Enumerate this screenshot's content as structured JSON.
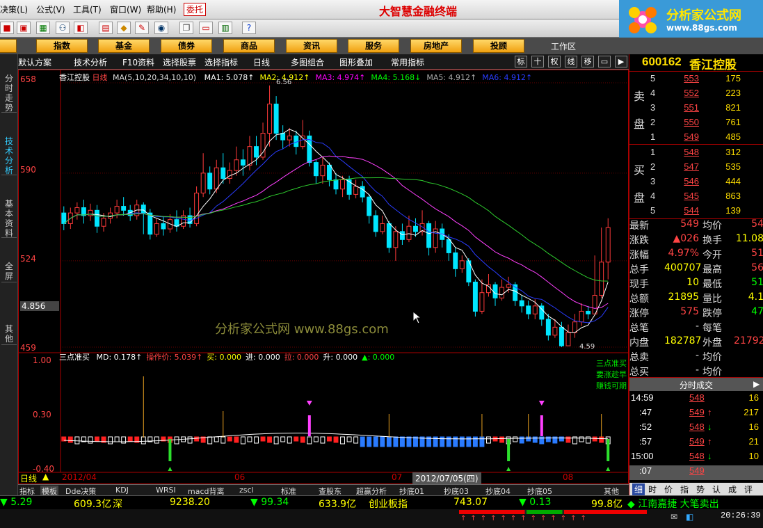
{
  "menu": {
    "items": [
      "决策(L)",
      "公式(V)",
      "工具(T)",
      "窗口(W)",
      "帮助(H)"
    ],
    "trade": "委托",
    "app_title": "大智慧金融终端"
  },
  "logo": {
    "name": "分析家公式网",
    "url": "www.88gs.com"
  },
  "categories": [
    "股",
    "指数",
    "基金",
    "债券",
    "商品",
    "资讯",
    "服务",
    "房地产",
    "投顾"
  ],
  "workarea": "工作区",
  "side_tabs": [
    "分时走势",
    "技术分析",
    "基本资料",
    "全屏",
    "其他"
  ],
  "chart_tabs": [
    "默认方案",
    "技术分析",
    "F10资料",
    "选择股票",
    "选择指标",
    "日线",
    "多图组合",
    "图形叠加",
    "常用指标"
  ],
  "chart_tools": [
    "标",
    "十",
    "权",
    "线",
    "移",
    "▭",
    "▶"
  ],
  "stock": {
    "code": "600162",
    "name": "香江控股"
  },
  "ma_line": {
    "label": "香江控股",
    "period": "日线",
    "ma": "MA(5,10,20,34,10,10)",
    "items": [
      {
        "t": "MA1: 5.078↑",
        "c": "#ffffff"
      },
      {
        "t": "MA2: 4.912↑",
        "c": "#ffff00"
      },
      {
        "t": "MA3: 4.974↑",
        "c": "#ff00ff"
      },
      {
        "t": "MA4: 5.168↓",
        "c": "#00ff00"
      },
      {
        "t": "MA5: 4.912↑",
        "c": "#aaaaaa"
      },
      {
        "t": "MA6: 4.912↑",
        "c": "#2a3cff"
      }
    ]
  },
  "y_labels": [
    "658",
    "590",
    "524",
    "459"
  ],
  "cursor_price": "4.856",
  "annotations": {
    "high": "6.56",
    "low": "4.59"
  },
  "watermark": "分析家公式网  www.88gs.com",
  "sub_header": {
    "name": "三点准买",
    "items": [
      {
        "t": "MD: 0.178↑",
        "c": "#ffffff"
      },
      {
        "t": "操作价: 5.039↑",
        "c": "#ff4444"
      },
      {
        "t": "买: 0.000",
        "c": "#ffff00"
      },
      {
        "t": "进: 0.000",
        "c": "#ffffff"
      },
      {
        "t": "拉: 0.000",
        "c": "#ff4444"
      },
      {
        "t": "升: 0.000",
        "c": "#ffffff"
      },
      {
        "t": "▲: 0.000",
        "c": "#00ff00"
      }
    ]
  },
  "sub_y": [
    "1.00",
    "0.30",
    "-0.40"
  ],
  "sub_note": [
    "三点准买",
    "要涨趁早",
    "赚钱可期"
  ],
  "x_axis": {
    "period": "日线",
    "months": [
      "2012/04",
      "06",
      "07",
      "08"
    ],
    "cursor_date": "2012/07/05(四)"
  },
  "bottom_tabs": [
    "指标",
    "模板",
    "Dde决策",
    "KDJ",
    "WRSI",
    "macd背离",
    "zscl",
    "标准",
    "查股东",
    "超赢分析",
    "抄底01",
    "抄底03",
    "抄底04",
    "抄底05",
    "其他"
  ],
  "orderbook": {
    "sell_label": [
      "卖",
      "盘"
    ],
    "buy_label": [
      "买",
      "盘"
    ],
    "sell": [
      {
        "l": "5",
        "p": "553",
        "v": "175"
      },
      {
        "l": "4",
        "p": "552",
        "v": "223"
      },
      {
        "l": "3",
        "p": "551",
        "v": "821"
      },
      {
        "l": "2",
        "p": "550",
        "v": "761"
      },
      {
        "l": "1",
        "p": "549",
        "v": "485"
      }
    ],
    "buy": [
      {
        "l": "1",
        "p": "548",
        "v": "312"
      },
      {
        "l": "2",
        "p": "547",
        "v": "535"
      },
      {
        "l": "3",
        "p": "546",
        "v": "444"
      },
      {
        "l": "4",
        "p": "545",
        "v": "863"
      },
      {
        "l": "5",
        "p": "544",
        "v": "139"
      }
    ]
  },
  "stats": [
    {
      "k1": "最新",
      "v1": "549",
      "c1": "#ff4444",
      "k2": "均价",
      "v2": "54",
      "c2": "#ff4444"
    },
    {
      "k1": "涨跌",
      "v1": "▲026",
      "c1": "#ff4444",
      "k2": "换手",
      "v2": "11.08",
      "c2": "#ffff00"
    },
    {
      "k1": "涨幅",
      "v1": "4.97%",
      "c1": "#ff4444",
      "k2": "今开",
      "v2": "51",
      "c2": "#ff4444"
    },
    {
      "k1": "总手",
      "v1": "400707",
      "c1": "#ffff00",
      "k2": "最高",
      "v2": "56",
      "c2": "#ff4444"
    },
    {
      "k1": "现手",
      "v1": "10",
      "c1": "#ffff00",
      "k2": "最低",
      "v2": "51",
      "c2": "#00ff00"
    },
    {
      "k1": "总额",
      "v1": "21895",
      "c1": "#ffff00",
      "k2": "量比",
      "v2": "4.1",
      "c2": "#ffff00"
    },
    {
      "k1": "涨停",
      "v1": "575",
      "c1": "#ff4444",
      "k2": "跌停",
      "v2": "47",
      "c2": "#00ff00"
    },
    {
      "k1": "总笔",
      "v1": "-",
      "c1": "#dddddd",
      "k2": "每笔",
      "v2": "",
      "c2": "#dddddd"
    },
    {
      "k1": "内盘",
      "v1": "182787",
      "c1": "#ffff00",
      "k2": "外盘",
      "v2": "21792",
      "c2": "#ff4444"
    },
    {
      "k1": "总卖",
      "v1": "-",
      "c1": "#dddddd",
      "k2": "均价",
      "v2": "",
      "c2": "#dddddd"
    },
    {
      "k1": "总买",
      "v1": "-",
      "c1": "#dddddd",
      "k2": "均价",
      "v2": "",
      "c2": "#dddddd"
    }
  ],
  "ticks_title": "分时成交",
  "ticks": [
    {
      "t": "14:59",
      "p": "548",
      "a": "",
      "v": "16"
    },
    {
      "t": ":47",
      "p": "549",
      "a": "↑",
      "v": "217"
    },
    {
      "t": ":52",
      "p": "548",
      "a": "↓",
      "v": "16"
    },
    {
      "t": ":57",
      "p": "549",
      "a": "↑",
      "v": "21"
    },
    {
      "t": "15:00",
      "p": "548",
      "a": "↓",
      "v": "10"
    },
    {
      "t": ":07",
      "p": "549",
      "a": "",
      "v": ""
    }
  ],
  "right_tabs": [
    "细",
    "时",
    "价",
    "指",
    "势",
    "认",
    "成",
    "评"
  ],
  "status": [
    {
      "t": "▼ 5.29",
      "c": "#00ff00"
    },
    {
      "t": "609.3亿",
      "c": "#ffff00"
    },
    {
      "t": "深",
      "c": "#ffff00"
    },
    {
      "t": "9238.20",
      "c": "#ffff00"
    },
    {
      "t": "▼ 99.34",
      "c": "#00ff00"
    },
    {
      "t": "633.9亿",
      "c": "#ffff00"
    },
    {
      "t": "创业板指",
      "c": "#ffff00"
    },
    {
      "t": "743.07",
      "c": "#ffff00"
    },
    {
      "t": "▼ 0.13",
      "c": "#00ff00"
    },
    {
      "t": "99.8亿",
      "c": "#ffff00"
    },
    {
      "t": "◆ 江南嘉捷 大笔卖出",
      "c": "#00ff00"
    }
  ],
  "clock": "20:26:39",
  "chart_data": {
    "type": "candlestick",
    "ylim": [
      4.59,
      6.58
    ],
    "y_ticks": [
      6.58,
      5.9,
      5.24,
      4.59
    ],
    "candles": [
      [
        5.6,
        5.52,
        5.65,
        5.47
      ],
      [
        5.52,
        5.6,
        5.64,
        5.48
      ],
      [
        5.6,
        5.64,
        5.68,
        5.55
      ],
      [
        5.64,
        5.58,
        5.7,
        5.52
      ],
      [
        5.58,
        5.62,
        5.67,
        5.54
      ],
      [
        5.62,
        5.5,
        5.66,
        5.45
      ],
      [
        5.5,
        5.56,
        5.6,
        5.46
      ],
      [
        5.56,
        5.6,
        5.64,
        5.52
      ],
      [
        5.6,
        5.65,
        5.7,
        5.56
      ],
      [
        5.65,
        5.62,
        5.72,
        5.58
      ],
      [
        5.62,
        5.58,
        5.66,
        5.54
      ],
      [
        5.58,
        5.66,
        5.7,
        5.55
      ],
      [
        5.66,
        5.6,
        5.68,
        5.44
      ],
      [
        5.6,
        5.44,
        5.63,
        5.4
      ],
      [
        5.44,
        5.52,
        5.56,
        5.42
      ],
      [
        5.52,
        5.48,
        5.57,
        5.43
      ],
      [
        5.48,
        5.55,
        5.59,
        5.45
      ],
      [
        5.55,
        5.5,
        5.62,
        5.46
      ],
      [
        5.5,
        5.58,
        5.62,
        5.48
      ],
      [
        5.58,
        5.52,
        5.64,
        5.49
      ],
      [
        5.52,
        5.75,
        5.8,
        5.5
      ],
      [
        5.75,
        5.9,
        6.05,
        5.72
      ],
      [
        5.9,
        5.78,
        5.95,
        5.74
      ],
      [
        5.78,
        5.94,
        6.0,
        5.75
      ],
      [
        5.94,
        5.86,
        6.05,
        5.82
      ],
      [
        5.86,
        5.92,
        5.98,
        5.82
      ],
      [
        5.92,
        6.0,
        6.1,
        5.88
      ],
      [
        6.0,
        5.96,
        6.08,
        5.88
      ],
      [
        5.96,
        6.1,
        6.18,
        5.92
      ],
      [
        6.1,
        6.02,
        6.18,
        5.96
      ],
      [
        6.02,
        6.2,
        6.28,
        6.0
      ],
      [
        6.2,
        6.42,
        6.56,
        6.1
      ],
      [
        6.42,
        6.2,
        6.48,
        6.15
      ],
      [
        6.2,
        6.15,
        6.26,
        6.08
      ],
      [
        6.15,
        6.18,
        6.24,
        6.1
      ],
      [
        6.18,
        6.1,
        6.22,
        6.04
      ],
      [
        6.1,
        6.18,
        6.3,
        6.08
      ],
      [
        6.18,
        5.98,
        6.22,
        5.95
      ],
      [
        5.98,
        5.88,
        6.0,
        5.82
      ],
      [
        5.88,
        5.96,
        6.02,
        5.82
      ],
      [
        5.96,
        5.85,
        5.98,
        5.8
      ],
      [
        5.85,
        5.78,
        5.9,
        5.74
      ],
      [
        5.78,
        5.85,
        5.88,
        5.72
      ],
      [
        5.85,
        5.74,
        5.88,
        5.7
      ],
      [
        5.74,
        5.8,
        5.85,
        5.71
      ],
      [
        5.8,
        5.72,
        5.84,
        5.68
      ],
      [
        5.72,
        5.58,
        5.74,
        5.52
      ],
      [
        5.58,
        5.46,
        5.62,
        5.42
      ],
      [
        5.46,
        5.52,
        5.58,
        5.44
      ],
      [
        5.52,
        5.34,
        5.54,
        5.3
      ],
      [
        5.34,
        5.46,
        5.5,
        5.24
      ],
      [
        5.46,
        5.4,
        5.52,
        5.36
      ],
      [
        5.4,
        5.5,
        5.58,
        5.38
      ],
      [
        5.5,
        5.46,
        5.56,
        5.42
      ],
      [
        5.46,
        5.52,
        5.62,
        5.43
      ],
      [
        5.52,
        5.34,
        5.54,
        5.28
      ],
      [
        5.34,
        5.48,
        5.54,
        5.3
      ],
      [
        5.48,
        5.4,
        5.52,
        5.34
      ],
      [
        5.4,
        5.3,
        5.44,
        5.24
      ],
      [
        5.3,
        5.18,
        5.34,
        5.12
      ],
      [
        5.18,
        5.24,
        5.28,
        5.15
      ],
      [
        5.24,
        5.08,
        5.26,
        5.05
      ],
      [
        5.08,
        4.86,
        5.1,
        4.82
      ],
      [
        4.86,
        5.0,
        5.1,
        4.84
      ],
      [
        5.0,
        5.06,
        5.14,
        4.97
      ],
      [
        5.06,
        4.96,
        5.08,
        4.9
      ],
      [
        4.96,
        5.04,
        5.1,
        4.94
      ],
      [
        5.04,
        5.06,
        5.12,
        5.0
      ],
      [
        5.06,
        4.94,
        5.08,
        4.9
      ],
      [
        4.94,
        4.9,
        4.98,
        4.85
      ],
      [
        4.9,
        4.84,
        4.94,
        4.8
      ],
      [
        4.84,
        4.9,
        4.95,
        4.8
      ],
      [
        4.9,
        4.8,
        4.92,
        4.75
      ],
      [
        4.8,
        4.68,
        4.84,
        4.64
      ],
      [
        4.68,
        4.74,
        4.8,
        4.66
      ],
      [
        4.74,
        4.6,
        4.78,
        4.59
      ],
      [
        4.6,
        4.7,
        4.76,
        4.62
      ],
      [
        4.7,
        4.78,
        4.84,
        4.66
      ],
      [
        4.78,
        4.86,
        4.92,
        4.75
      ],
      [
        4.86,
        4.84,
        4.9,
        4.8
      ],
      [
        4.84,
        4.98,
        5.28,
        4.84
      ],
      [
        4.98,
        5.23,
        5.49,
        4.96
      ],
      [
        5.23,
        5.49,
        5.56,
        5.1
      ]
    ],
    "ma_series": [
      {
        "name": "MA1",
        "color": "#ffffff"
      },
      {
        "name": "MA2",
        "color": "#2a3cff"
      },
      {
        "name": "MA3",
        "color": "#ff40ff"
      },
      {
        "name": "MA4",
        "color": "#2ecc2e"
      }
    ]
  }
}
